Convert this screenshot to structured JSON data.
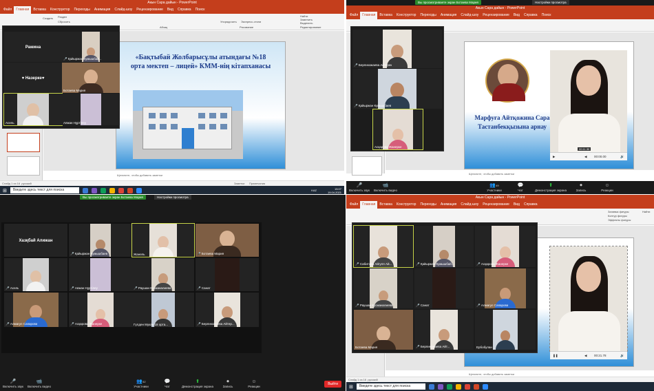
{
  "q1": {
    "title": "Акын Сара дайын - PowerPoint",
    "tabs": [
      "Файл",
      "Главная",
      "Вставка",
      "Конструктор",
      "Переходы",
      "Анимация",
      "Слайд-шоу",
      "Рецензирование",
      "Вид",
      "Справка",
      "Поиск"
    ],
    "ribbon": {
      "create": "Создать",
      "reset": "Сбросить",
      "section": "Раздел",
      "slides": "Слайды",
      "font": "Шрифт",
      "paragraph": "Абзац",
      "arrange": "Упорядочить",
      "express_styles": "Экспресс-стили",
      "drawing": "Рисование",
      "find": "Найти",
      "replace": "Заменить",
      "select": "Выделить",
      "editing": "Редактирование"
    },
    "slide_title": "«Бақтыбай Жолбарысұлы атындағы №18 орта мектеп – лицей» КММ-нің кітапханасы",
    "notes": "Щелкните, чтобы добавить заметки",
    "status": {
      "slide": "Слайд 1 из 16",
      "lang": "русский",
      "notes": "Заметки",
      "comments": "Примечания",
      "zoom": "53%"
    },
    "search": "Введите здесь текст для поиска",
    "clock": {
      "time": "15:07",
      "temp": "KAZ",
      "date": "19.04.2021"
    },
    "participants": [
      {
        "name": "Рамина",
        "type": "label"
      },
      {
        "name": "Қайыржан Кумышбай...",
        "type": "video"
      },
      {
        "name": "♥ Назерке♥",
        "type": "label"
      },
      {
        "name": "Ботаева Мария",
        "type": "video"
      },
      {
        "name": "Асель",
        "type": "video"
      },
      {
        "name": "Аяжан Нұртілеу",
        "type": "video"
      }
    ]
  },
  "q2": {
    "viewing_banner": "Вы просматриваете экран Ботаева Мария",
    "view_options": "Настройки просмотра",
    "title": "Акын Сара дайын - PowerPoint",
    "author": "Нейтен Кудайберген",
    "tabs": [
      "Файл",
      "Главная",
      "Вставка",
      "Конструктор",
      "Переходы",
      "Анимация",
      "Слайд-шоу",
      "Рецензирование",
      "Вид",
      "Справка",
      "Поиск"
    ],
    "slide_text": "Марфуға Айтқожина Сара Тастанбекқызына арнау",
    "video_time": "00:00.00",
    "timestamp_badge": "00:11.30",
    "notes": "Щелкните, чтобы добавить заметки",
    "participants": [
      {
        "name": "Берликожаева Айтерек"
      },
      {
        "name": "Қайыржан Кумышбаев"
      },
      {
        "name": "Асқарова Жанерке"
      }
    ],
    "zoombar": [
      {
        "icon": "🎤",
        "label": "Включить звук"
      },
      {
        "icon": "📹",
        "label": "Включить видео"
      },
      {
        "icon": "👥",
        "label": "Участники",
        "count": "49"
      },
      {
        "icon": "💬",
        "label": "Чат"
      },
      {
        "icon": "⬆",
        "label": "Демонстрация экрана"
      },
      {
        "icon": "⏺",
        "label": "Запись"
      },
      {
        "icon": "☺",
        "label": "Реакции"
      }
    ]
  },
  "q3": {
    "viewing_banner": "Вы просматриваете экран Ботаева Мария",
    "view_options": "Настройки просмотра",
    "tiles": [
      {
        "name": "Хазқбай Алижан",
        "type": "label"
      },
      {
        "name": "Қайыржан Кумышбаев",
        "type": "video"
      },
      {
        "name": "Жанель",
        "type": "video"
      },
      {
        "name": "Ботаева Мария",
        "type": "video"
      },
      {
        "name": "Асель",
        "type": "video"
      },
      {
        "name": "Аяжан Нұртілеу",
        "type": "video"
      },
      {
        "name": "Раушан Кусманалиева",
        "type": "video"
      },
      {
        "name": "Санат",
        "type": "video"
      },
      {
        "name": "Алмагул Сапарова",
        "type": "video"
      },
      {
        "name": "Асқарова Жанерке",
        "type": "video"
      },
      {
        "name": "Гүлден Мукан 18 орта...",
        "type": "video"
      },
      {
        "name": "Берликожаева Айтер...",
        "type": "video"
      }
    ],
    "zoombar": [
      {
        "icon": "🎤",
        "label": "Включить звук"
      },
      {
        "icon": "📹",
        "label": "Включить видео"
      },
      {
        "icon": "👥",
        "label": "Участники",
        "count": "52"
      },
      {
        "icon": "💬",
        "label": "Чат"
      },
      {
        "icon": "⬆",
        "label": "Демонстрация экрана"
      },
      {
        "icon": "⏺",
        "label": "Запись"
      },
      {
        "icon": "☺",
        "label": "Реакции"
      }
    ],
    "end_label": "Выйти"
  },
  "q4": {
    "title": "Акын Сара дайын - PowerPoint",
    "tabs": [
      "Файл",
      "Главная",
      "Вставка",
      "Конструктор",
      "Переходы",
      "Анимация",
      "Слайд-шоу",
      "Рецензирование",
      "Вид",
      "Справка"
    ],
    "right_pane": {
      "shape_fill": "Заливка фигуры",
      "shape_outline": "Контур фигуры",
      "shape_effects": "Эффекты фигуры",
      "find": "Найти"
    },
    "tiles": [
      {
        "name": "Сабитова Айгуля Ай...",
        "hl": true
      },
      {
        "name": "Қайыржан Кумышбай...",
        "hl": false
      },
      {
        "name": "Асқарова Жанерке",
        "hl": false
      },
      {
        "name": "Раушан Кусманалиева",
        "hl": false
      },
      {
        "name": "Санат",
        "hl": false
      },
      {
        "name": "Алмагул Сапарова",
        "hl": false
      },
      {
        "name": "Ботаева Мария",
        "hl": false
      },
      {
        "name": "Берликожаева Айт...",
        "hl": false
      },
      {
        "name": "Ербобулан",
        "hl": false
      }
    ],
    "video_time": "00:21.78",
    "notes": "Щелкните, чтобы добавить заметки",
    "status": {
      "slide": "Слайд 1 из 16",
      "lang": "русский"
    },
    "search": "Введите здесь текст для поиска"
  }
}
